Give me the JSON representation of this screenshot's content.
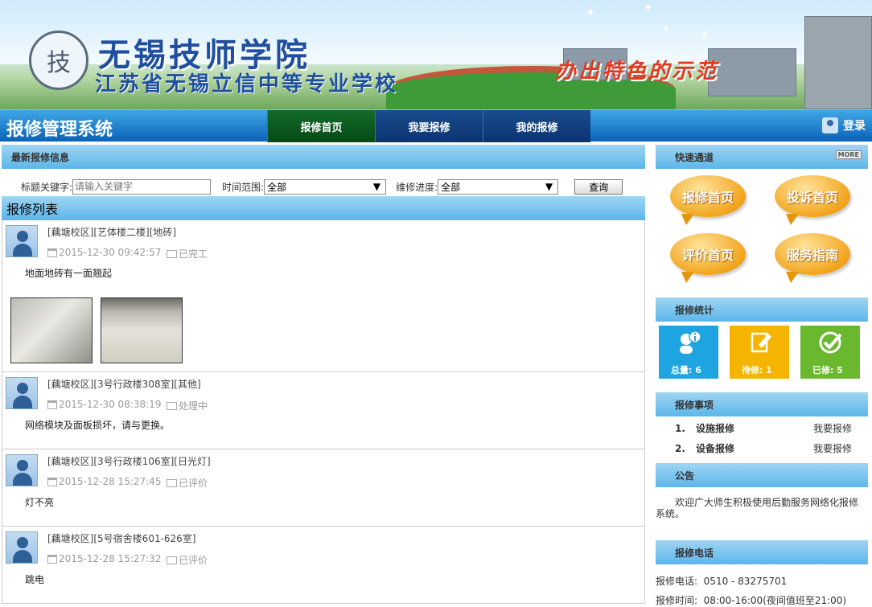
{
  "banner": {
    "seal_char": "技",
    "school_name": "无锡技师学院",
    "school_subtitle": "江苏省无锡立信中等专业学校",
    "slogan": "办出特色的示范"
  },
  "nav": {
    "system_name": "报修管理系统",
    "tabs": [
      {
        "label": "报修首页"
      },
      {
        "label": "我要报修"
      },
      {
        "label": "我的报修"
      }
    ],
    "login_label": "登录"
  },
  "latest": {
    "title": "最新报修信息"
  },
  "filter": {
    "keyword_label": "标题关键字:",
    "keyword_placeholder": "请输入关键字",
    "time_label": "时间范围:",
    "time_value": "全部",
    "progress_label": "维修进度:",
    "progress_value": "全部",
    "search_label": "查询"
  },
  "list": {
    "title": "报修列表",
    "items": [
      {
        "location": "[藕塘校区][艺体楼二楼][地砖]",
        "time": "2015-12-30 09:42:57",
        "status": "已完工",
        "desc": "地面地砖有一面翘起"
      },
      {
        "location": "[藕塘校区][3号行政楼308室][其他]",
        "time": "2015-12-30 08:38:19",
        "status": "处理中",
        "desc": "网络模块及面板损坏，请与更换。"
      },
      {
        "location": "[藕塘校区][3号行政楼106室][日光灯]",
        "time": "2015-12-28 15:27:45",
        "status": "已评价",
        "desc": "灯不亮"
      },
      {
        "location": "[藕塘校区][5号宿舍楼601-626室]",
        "time": "2015-12-28 15:27:32",
        "status": "已评价",
        "desc": "跳电"
      }
    ]
  },
  "quick": {
    "title": "快速通道",
    "more": "MORE",
    "buttons": [
      {
        "label": "报修首页"
      },
      {
        "label": "投诉首页"
      },
      {
        "label": "评价首页"
      },
      {
        "label": "服务指南"
      }
    ]
  },
  "stats": {
    "title": "报修统计",
    "total": "总量: 6",
    "pending": "待修: 1",
    "done": "已修: 5",
    "colors": {
      "total": "#1ea4e0",
      "pending": "#f5b400",
      "done": "#6ab82e"
    }
  },
  "matters": {
    "title": "报修事项",
    "items": [
      {
        "num": "1.",
        "label": "设施报修",
        "action": "我要报修"
      },
      {
        "num": "2.",
        "label": "设备报修",
        "action": "我要报修"
      }
    ]
  },
  "notice": {
    "title": "公告",
    "text": "欢迎广大师生积极使用后勤服务网络化报修系统。"
  },
  "phone": {
    "title": "报修电话",
    "phone_line": "报修电话:  0510 - 83275701",
    "hours_line": "报修时间:  08:00-16:00(夜间值班至21:00)"
  }
}
